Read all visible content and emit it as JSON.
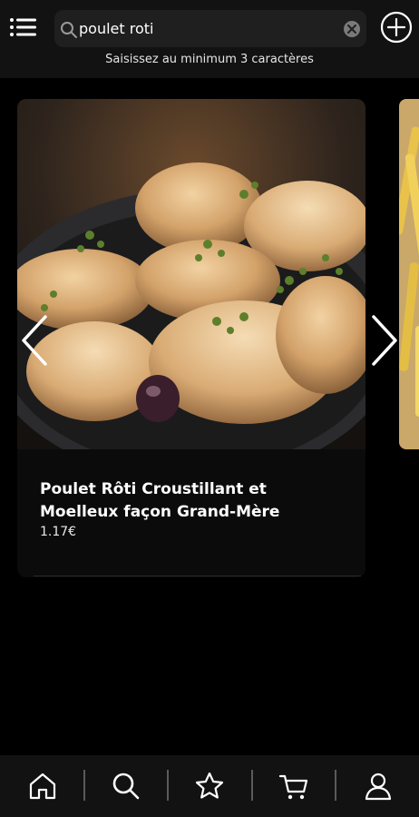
{
  "search": {
    "value": "poulet roti",
    "hint": "Saisissez au minimum 3 caractères"
  },
  "icons": {
    "menu": "menu-icon",
    "search": "search-icon",
    "clear": "clear-icon",
    "add": "plus-circle-icon",
    "prev": "chevron-left-icon",
    "next": "chevron-right-icon"
  },
  "card": {
    "title": "Poulet Rôti Croustillant et Moelleux façon Grand-Mère",
    "price": "1.17€",
    "image": "roast-chicken-pan-photo"
  },
  "next_card": {
    "image": "fries-photo"
  },
  "bottom_nav": {
    "items": [
      {
        "name": "home",
        "icon": "home-icon"
      },
      {
        "name": "search",
        "icon": "search-icon"
      },
      {
        "name": "favorites",
        "icon": "star-icon"
      },
      {
        "name": "cart",
        "icon": "cart-icon"
      },
      {
        "name": "profile",
        "icon": "user-icon"
      }
    ]
  },
  "colors": {
    "background": "#000000",
    "bar": "#121212",
    "search_field": "#1f1f1f",
    "text": "#ffffff"
  }
}
